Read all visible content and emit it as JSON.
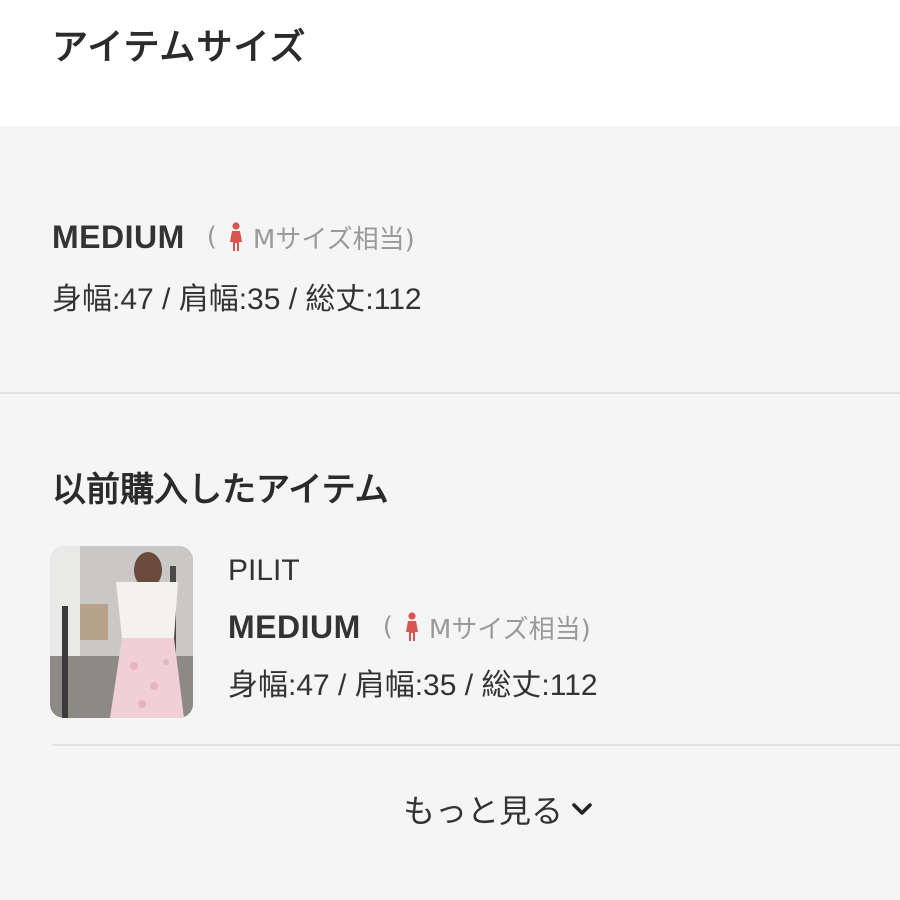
{
  "header": {
    "title": "アイテムサイズ"
  },
  "current_size": {
    "name": "MEDIUM",
    "equiv_prefix": "(",
    "equiv_label": "Mサイズ相当)",
    "measurements": "身幅:47 / 肩幅:35 / 総丈:112"
  },
  "previous": {
    "title": "以前購入したアイテム",
    "items": [
      {
        "brand": "PILIT",
        "size_name": "MEDIUM",
        "equiv_prefix": "(",
        "equiv_label": "Mサイズ相当)",
        "measurements": "身幅:47 / 肩幅:35 / 総丈:112"
      }
    ]
  },
  "more": {
    "label": "もっと見る"
  },
  "colors": {
    "accent_icon": "#d9534f",
    "muted_text": "#9a9a9a",
    "panel_bg": "#f5f5f5"
  }
}
